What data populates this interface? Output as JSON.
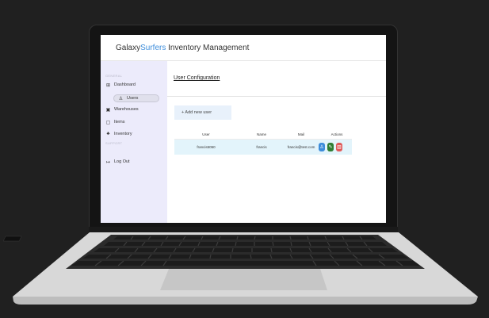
{
  "app": {
    "brand_part1": "Galaxy",
    "brand_part2": "Surfers",
    "brand_part3": " Inventory Management"
  },
  "sidebar": {
    "section_general": "GENERAL",
    "section_support": "SUPPORT",
    "items": [
      {
        "label": "Dashboard",
        "icon": "dashboard-icon"
      },
      {
        "label": "Users",
        "icon": "user-icon"
      },
      {
        "label": "Warehouses",
        "icon": "warehouse-icon"
      },
      {
        "label": "Items",
        "icon": "items-icon"
      },
      {
        "label": "Inventory",
        "icon": "inventory-icon"
      }
    ],
    "logout": {
      "label": "Log Out",
      "icon": "logout-icon"
    }
  },
  "main": {
    "title": "User Configuration",
    "add_button": "+ Add new user",
    "table": {
      "columns": [
        "User",
        "Name",
        "Mail",
        "Actions"
      ],
      "rows": [
        {
          "user": "francis5050",
          "name": "francis",
          "mail": "francis@test.com"
        }
      ]
    },
    "action_icons": [
      "view-icon",
      "edit-icon",
      "delete-icon"
    ]
  },
  "colors": {
    "brand_accent": "#3d8ddb",
    "sidebar_bg": "#ecebfb",
    "row_highlight": "#e3f4fb",
    "edit": "#2e7d32",
    "delete": "#e05a5a"
  }
}
